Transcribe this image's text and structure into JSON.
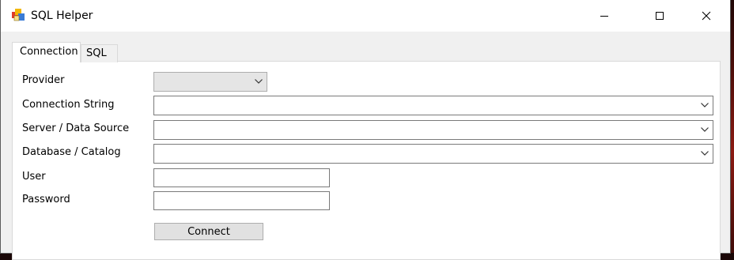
{
  "window": {
    "title": "SQL Helper",
    "icon": "app-icon"
  },
  "tabs": [
    {
      "label": "Connection",
      "selected": true
    },
    {
      "label": "SQL",
      "selected": false
    }
  ],
  "form": {
    "provider": {
      "label": "Provider",
      "value": ""
    },
    "connection_string": {
      "label": "Connection String",
      "value": ""
    },
    "server": {
      "label": "Server / Data Source",
      "value": ""
    },
    "database": {
      "label": "Database / Catalog",
      "value": ""
    },
    "user": {
      "label": "User",
      "value": ""
    },
    "password": {
      "label": "Password",
      "value": ""
    }
  },
  "actions": {
    "connect_label": "Connect"
  },
  "colors": {
    "window_bg": "#f0f0f0",
    "panel_bg": "#ffffff",
    "button_bg": "#e1e1e1",
    "border": "#7a7a7a"
  }
}
